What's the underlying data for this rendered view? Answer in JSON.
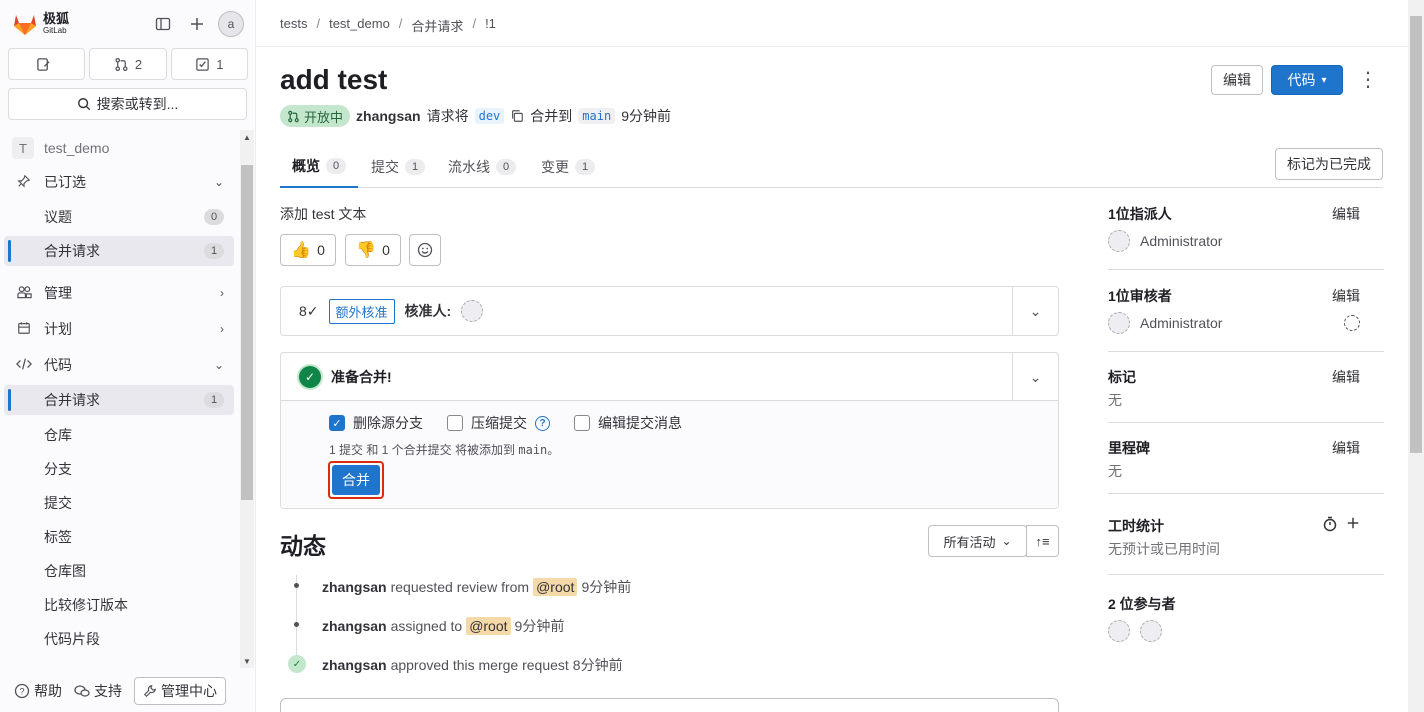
{
  "app": {
    "logo_text": "极狐",
    "logo_sub": "GitLab"
  },
  "sidebar": {
    "counters": [
      {
        "icon": "issues-icon",
        "count": ""
      },
      {
        "icon": "merge-request-icon",
        "count": "2"
      },
      {
        "icon": "todo-icon",
        "count": "1"
      }
    ],
    "search_label": "搜索或转到...",
    "project_letter": "T",
    "project_name": "test_demo",
    "items": [
      {
        "label": "已订选"
      },
      {
        "label": "议题",
        "badge": "0"
      },
      {
        "label": "合并请求",
        "badge": "1"
      },
      {
        "label": "管理"
      },
      {
        "label": "计划"
      },
      {
        "label": "代码"
      },
      {
        "label": "合并请求",
        "badge": "1"
      },
      {
        "label": "仓库"
      },
      {
        "label": "分支"
      },
      {
        "label": "提交"
      },
      {
        "label": "标签"
      },
      {
        "label": "仓库图"
      },
      {
        "label": "比较修订版本"
      },
      {
        "label": "代码片段"
      }
    ],
    "footer": {
      "help": "帮助",
      "support": "支持",
      "admin": "管理中心"
    }
  },
  "breadcrumb": [
    "tests",
    "test_demo",
    "合并请求",
    "!1"
  ],
  "mr": {
    "title": "add test",
    "edit_label": "编辑",
    "code_label": "代码",
    "status": "开放中",
    "author": "zhangsan",
    "requests_text": "请求将",
    "source_branch": "dev",
    "merge_into_text": "合并到",
    "target_branch": "main",
    "time": "9分钟前",
    "mark_done_label": "标记为已完成"
  },
  "tabs": [
    {
      "label": "概览",
      "count": "0"
    },
    {
      "label": "提交",
      "count": "1"
    },
    {
      "label": "流水线",
      "count": "0"
    },
    {
      "label": "变更",
      "count": "1"
    }
  ],
  "description": "添加 test 文本",
  "reactions": {
    "thumbs_up": "0",
    "thumbs_down": "0"
  },
  "approval": {
    "extra_label": "额外核准",
    "approvers_label": "核准人:"
  },
  "ready": {
    "title": "准备合并!",
    "delete_source": "删除源分支",
    "squash": "压缩提交",
    "edit_message": "编辑提交消息",
    "note_prefix": "1 提交 和 1 个合并提交 将被添加到",
    "note_branch": "main",
    "note_suffix": "。",
    "merge_label": "合并"
  },
  "activity": {
    "title": "动态",
    "filter_label": "所有活动",
    "items": [
      {
        "user": "zhangsan",
        "text": "requested review from",
        "mention": "@root",
        "time": "9分钟前"
      },
      {
        "user": "zhangsan",
        "text": "assigned to",
        "mention": "@root",
        "time": "9分钟前"
      },
      {
        "user": "zhangsan",
        "text": "approved this merge request",
        "mention": "",
        "time": "8分钟前"
      }
    ]
  },
  "right": {
    "assignees_title": "1位指派人",
    "assignee": "Administrator",
    "reviewers_title": "1位审核者",
    "reviewer": "Administrator",
    "labels_title": "标记",
    "labels_value": "无",
    "milestone_title": "里程碑",
    "milestone_value": "无",
    "time_title": "工时统计",
    "time_value": "无预计或已用时间",
    "participants_title": "2 位参与者",
    "edit_label": "编辑"
  },
  "colors": {
    "accent": "#1f75cb",
    "success": "#108548",
    "danger_outline": "#dd2b0e"
  }
}
